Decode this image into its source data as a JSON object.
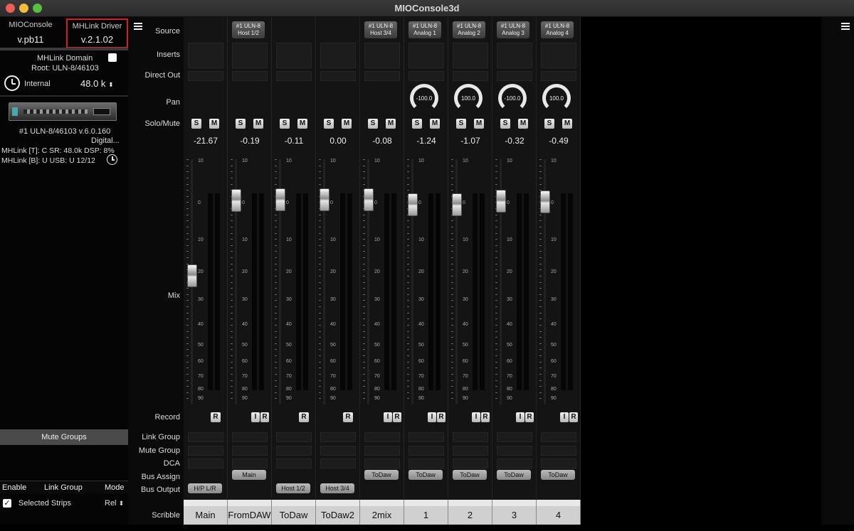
{
  "window": {
    "title": "MIOConsole3d"
  },
  "colors": {
    "highlight_border": "#d02020",
    "strip_bg": "#141414"
  },
  "sidebar": {
    "app_label": "MIOConsole",
    "app_version": "v.pb11",
    "driver_label": "MHLink Driver",
    "driver_version": "v.2.1.02",
    "domain_label": "MHLink Domain",
    "domain_root": "Root: ULN-8/46103",
    "clock_source": "Internal",
    "sample_rate": "48.0 k",
    "device_name": "#1 ULN-8/46103 v.6.0.160",
    "device_sub": "Digital...",
    "mhlink_t": "MHLink [T]: C SR: 48.0k DSP: 8%",
    "mhlink_b": "MHLink [B]: U USB: U 12/12",
    "mute_groups": "Mute Groups",
    "cols": {
      "enable": "Enable",
      "link_group": "Link Group",
      "mode": "Mode"
    },
    "selected_strips": "Selected Strips",
    "mode_value": "Rel"
  },
  "row_labels": {
    "source": "Source",
    "inserts": "Inserts",
    "direct_out": "Direct Out",
    "pan": "Pan",
    "solo_mute": "Solo/Mute",
    "mix": "Mix",
    "record": "Record",
    "link_group": "Link Group",
    "mute_group": "Mute Group",
    "dca": "DCA",
    "bus_assign": "Bus Assign",
    "bus_output": "Bus Output",
    "scribble": "Scribble"
  },
  "buttons": {
    "solo": "S",
    "mute": "M",
    "rec": "R",
    "input": "I"
  },
  "scale_labels": [
    "10",
    "0",
    "10",
    "20",
    "30",
    "40",
    "50",
    "60",
    "70",
    "80",
    "90"
  ],
  "strips": [
    {
      "src1": "",
      "src2": "",
      "db": "-21.67",
      "pan": null,
      "bus_assign": "",
      "bus_output": "H/P L/R",
      "scribble": "Main",
      "fader": 0.335,
      "rec_i": false
    },
    {
      "src1": "#1 ULN-8",
      "src2": "Host 1/2",
      "db": "-0.19",
      "pan": null,
      "bus_assign": "Main",
      "bus_output": "",
      "scribble": "FromDAW",
      "fader": 0.028,
      "rec_i": true
    },
    {
      "src1": "",
      "src2": "",
      "db": "-0.11",
      "pan": null,
      "bus_assign": "",
      "bus_output": "Host 1/2",
      "scribble": "ToDaw",
      "fader": 0.027,
      "rec_i": false
    },
    {
      "src1": "",
      "src2": "",
      "db": "0.00",
      "pan": null,
      "bus_assign": "",
      "bus_output": "Host 3/4",
      "scribble": "ToDaw2",
      "fader": 0.025,
      "rec_i": false
    },
    {
      "src1": "#1 ULN-8",
      "src2": "Host 3/4",
      "db": "-0.08",
      "pan": null,
      "bus_assign": "ToDaw",
      "bus_output": "",
      "scribble": "2mix",
      "fader": 0.026,
      "rec_i": true
    },
    {
      "src1": "#1 ULN-8",
      "src2": "Analog 1",
      "db": "-1.24",
      "pan": "-100.0",
      "bus_assign": "ToDaw",
      "bus_output": "",
      "scribble": "1",
      "fader": 0.047,
      "rec_i": true
    },
    {
      "src1": "#1 ULN-8",
      "src2": "Analog 2",
      "db": "-1.07",
      "pan": "100.0",
      "bus_assign": "ToDaw",
      "bus_output": "",
      "scribble": "2",
      "fader": 0.045,
      "rec_i": true
    },
    {
      "src1": "#1 ULN-8",
      "src2": "Analog 3",
      "db": "-0.32",
      "pan": "-100.0",
      "bus_assign": "ToDaw",
      "bus_output": "",
      "scribble": "3",
      "fader": 0.031,
      "rec_i": true
    },
    {
      "src1": "#1 ULN-8",
      "src2": "Analog 4",
      "db": "-0.49",
      "pan": "100.0",
      "bus_assign": "ToDaw",
      "bus_output": "",
      "scribble": "4",
      "fader": 0.034,
      "rec_i": true
    }
  ]
}
